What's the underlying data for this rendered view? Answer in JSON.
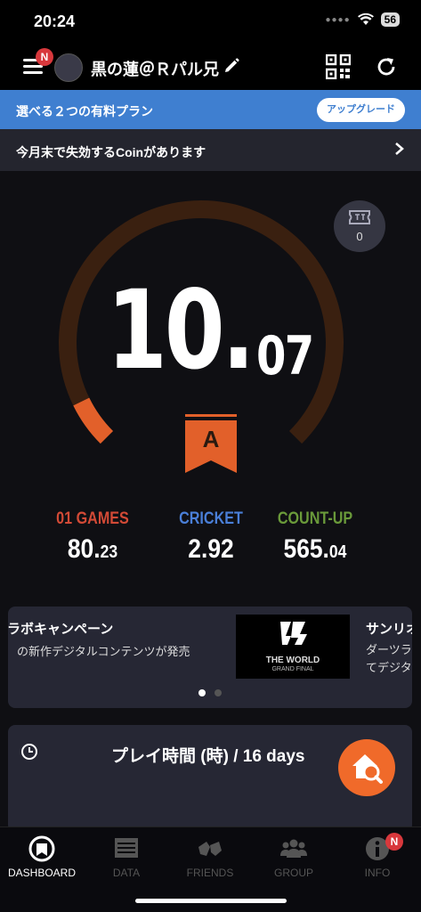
{
  "status": {
    "time": "20:24",
    "battery": "56"
  },
  "header": {
    "username": "黒の蓮＠Ｒパル兄",
    "menu_badge": "N",
    "icons": [
      "menu-icon",
      "edit-icon",
      "qr-code-icon",
      "refresh-icon"
    ]
  },
  "plan_banner": {
    "text": "選べる２つの有料プラン",
    "button": "アップグレード"
  },
  "coin_notice": {
    "text": "今月末で失効するCoinがあります"
  },
  "ticket": {
    "count": "0"
  },
  "rating": {
    "integer": "10.",
    "decimal": "07",
    "rank": "A",
    "gauge_fraction": 0.07
  },
  "stats": [
    {
      "label": "01 GAMES",
      "value_main": "80.",
      "value_small": "23",
      "color": "#d24a36"
    },
    {
      "label": "CRICKET",
      "value_main": "2.92",
      "value_small": "",
      "color": "#4a7fd8"
    },
    {
      "label": "COUNT-UP",
      "value_main": "565.",
      "value_small": "04",
      "color": "#6a9a3a"
    }
  ],
  "campaign": {
    "title": "コラボキャンペーン",
    "subtitle": "の新作デジタルコンテンツが発売",
    "image_title": "THE WORLD",
    "image_subtitle": "GRAND FINAL",
    "right_title": "サンリオ",
    "right_line1": "ダーツライ",
    "right_line2": "てデジタル",
    "pages": 2,
    "active_page": 1
  },
  "playtime": {
    "title": "プレイ時間 (時) / 16 days"
  },
  "tabs": [
    {
      "label": "DASHBOARD",
      "icon": "dashboard-icon",
      "active": true
    },
    {
      "label": "DATA",
      "icon": "data-icon",
      "active": false
    },
    {
      "label": "FRIENDS",
      "icon": "friends-icon",
      "active": false
    },
    {
      "label": "GROUP",
      "icon": "group-icon",
      "active": false
    },
    {
      "label": "INFO",
      "icon": "info-icon",
      "active": false,
      "badge": "N"
    }
  ],
  "colors": {
    "accent_orange": "#e2602a",
    "gauge_track": "#3a2010",
    "plan_blue": "#3f7fd0",
    "badge_red": "#d8383c"
  }
}
